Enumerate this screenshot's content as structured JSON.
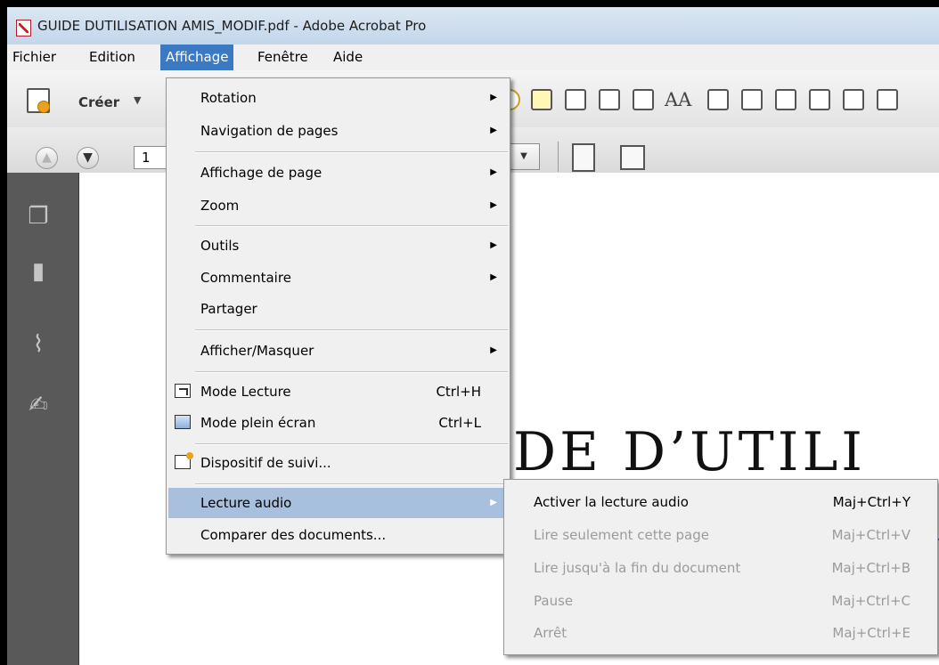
{
  "window": {
    "title": "GUIDE DUTILISATION AMIS_MODIF.pdf - Adobe Acrobat Pro"
  },
  "menubar": {
    "items": [
      "Fichier",
      "Edition",
      "Affichage",
      "Fenêtre",
      "Aide"
    ]
  },
  "toolbar": {
    "create_label": "Créer",
    "aa_label": "AA"
  },
  "navigation": {
    "page_number": "1"
  },
  "document": {
    "heading_fragment": "DE D’UTILI"
  },
  "affichage_menu": {
    "items": [
      {
        "label": "Rotation"
      },
      {
        "label": "Navigation de pages"
      },
      {
        "label": "Affichage de page"
      },
      {
        "label": "Zoom"
      },
      {
        "label": "Outils"
      },
      {
        "label": "Commentaire"
      },
      {
        "label": "Partager"
      },
      {
        "label": "Afficher/Masquer"
      },
      {
        "label": "Mode Lecture",
        "shortcut": "Ctrl+H"
      },
      {
        "label": "Mode plein écran",
        "shortcut": "Ctrl+L"
      },
      {
        "label": "Dispositif de suivi..."
      },
      {
        "label": "Lecture audio"
      },
      {
        "label": "Comparer des documents..."
      }
    ]
  },
  "lecture_audio_submenu": {
    "items": [
      {
        "label": "Activer la lecture audio",
        "shortcut": "Maj+Ctrl+Y"
      },
      {
        "label": "Lire seulement cette page",
        "shortcut": "Maj+Ctrl+V"
      },
      {
        "label": "Lire jusqu'à la fin du document",
        "shortcut": "Maj+Ctrl+B"
      },
      {
        "label": "Pause",
        "shortcut": "Maj+Ctrl+C"
      },
      {
        "label": "Arrêt",
        "shortcut": "Maj+Ctrl+E"
      }
    ]
  },
  "colors": {
    "menu_highlight": "#a8c0de",
    "menubar_active": "#3b79c2",
    "sidebar": "#595959",
    "heading_rule": "#3f6fb4"
  }
}
